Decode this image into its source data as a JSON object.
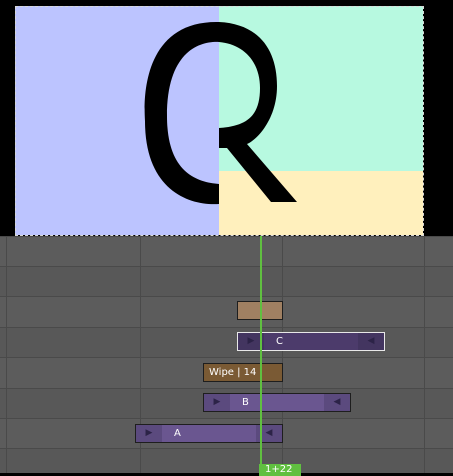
{
  "preview": {
    "colors": {
      "left_panel": "#bcc4ff",
      "top_right_panel": "#b7f9e0",
      "bottom_right_panel": "#fff0bd",
      "glyph": "#000000"
    }
  },
  "timeline": {
    "strips": {
      "a": {
        "label": "A"
      },
      "b": {
        "label": "B"
      },
      "c": {
        "label": "C"
      },
      "wipe": {
        "label": "Wipe | 14"
      }
    },
    "current_frame": "1+22"
  }
}
